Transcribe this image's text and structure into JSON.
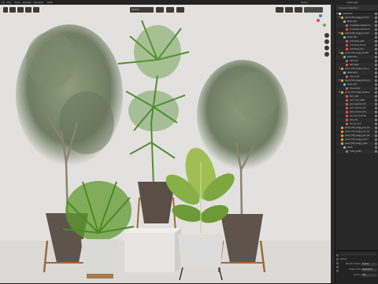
{
  "topbar": {
    "menu_items": [
      "File",
      "Edit",
      "Render",
      "Window",
      "Help"
    ],
    "mode": "Object Mode",
    "view_label": "Global",
    "scene_label": "Scene",
    "view_layer_label": "ViewLayer"
  },
  "outliner": {
    "title": "Scene Collection",
    "rows": [
      {
        "label": "Collection",
        "indent": 1,
        "type": "collection",
        "expanded": true
      },
      {
        "label": "plant_T06_Dagg_Cochlr",
        "indent": 2,
        "type": "empty",
        "expanded": true
      },
      {
        "label": "Mesh.001",
        "indent": 3,
        "type": "mesh"
      },
      {
        "label": "Crosshaircutlinkcurl",
        "indent": 4,
        "type": "material"
      },
      {
        "label": "Crosshaircutlinkcurl",
        "indent": 4,
        "type": "material"
      },
      {
        "label": "plant_T06_Dagg_Cochlr",
        "indent": 2,
        "type": "empty",
        "expanded": true
      },
      {
        "label": "Mesh.002",
        "indent": 3,
        "type": "mesh"
      },
      {
        "label": "dracaena_leaf",
        "indent": 4,
        "type": "material"
      },
      {
        "label": "dracaena_trunk",
        "indent": 4,
        "type": "material"
      },
      {
        "label": "dracaena_pot",
        "indent": 4,
        "type": "material"
      },
      {
        "label": "plant_T06_Dagg_Dieffe",
        "indent": 2,
        "type": "empty",
        "expanded": true
      },
      {
        "label": "Mesh.003",
        "indent": 3,
        "type": "mesh"
      },
      {
        "label": "diff_leaf",
        "indent": 4,
        "type": "material"
      },
      {
        "label": "diff_stem",
        "indent": 4,
        "type": "material"
      },
      {
        "label": "plant_T06_Dagg_Olive_L",
        "indent": 2,
        "type": "empty",
        "expanded": true
      },
      {
        "label": "Mesh.004",
        "indent": 3,
        "type": "mesh"
      },
      {
        "label": "olive_leaf",
        "indent": 4,
        "type": "material"
      },
      {
        "label": "plant_T06_Dagg_Olive_R",
        "indent": 2,
        "type": "empty",
        "expanded": true
      },
      {
        "label": "Mesh.005",
        "indent": 3,
        "type": "mesh"
      },
      {
        "label": "olive_bark",
        "indent": 4,
        "type": "material"
      },
      {
        "label": "plant_T06_Dagg_Nephro",
        "indent": 2,
        "type": "empty",
        "expanded": true
      },
      {
        "label": "fern_leaf",
        "indent": 4,
        "type": "material"
      },
      {
        "label": "pot_ring_metal",
        "indent": 4,
        "type": "material"
      },
      {
        "label": "pot_ceramic_01",
        "indent": 4,
        "type": "material"
      },
      {
        "label": "pot_ceramic_02",
        "indent": 4,
        "type": "material"
      },
      {
        "label": "pot_ceramic_03",
        "indent": 4,
        "type": "material"
      },
      {
        "label": "pot_wood_stand",
        "indent": 4,
        "type": "material"
      },
      {
        "label": "pot_soil",
        "indent": 4,
        "type": "material"
      },
      {
        "label": "pot_ground",
        "indent": 4,
        "type": "material"
      },
      {
        "label": "plant_T06_Dagg_pot_01",
        "indent": 2,
        "type": "empty"
      },
      {
        "label": "plant_T06_Dagg_pot_02",
        "indent": 2,
        "type": "empty"
      },
      {
        "label": "plant_T06_Dagg_pot_03",
        "indent": 2,
        "type": "empty"
      },
      {
        "label": "plant_T06_Dagg_stand",
        "indent": 2,
        "type": "empty"
      },
      {
        "label": "plant_T06_Dagg_cube",
        "indent": 2,
        "type": "empty"
      },
      {
        "label": "Mesh",
        "indent": 3,
        "type": "mesh"
      },
      {
        "label": "cube_white",
        "indent": 4,
        "type": "material"
      }
    ]
  },
  "properties": {
    "search_placeholder": "",
    "section": "Scene",
    "rows": [
      {
        "label": "Render Engine",
        "value": "Cycles"
      },
      {
        "label": "Feature Set",
        "value": "Supported"
      },
      {
        "label": "Device",
        "value": "CPU"
      }
    ]
  },
  "colors": {
    "collection": "#d8d8d8",
    "empty": "#e39a3a",
    "mesh": "#5fb5d6",
    "material": "#d05a5a",
    "gizmo_x": "#e3454f",
    "gizmo_y": "#6ab53b",
    "gizmo_z": "#3f7fe6"
  }
}
